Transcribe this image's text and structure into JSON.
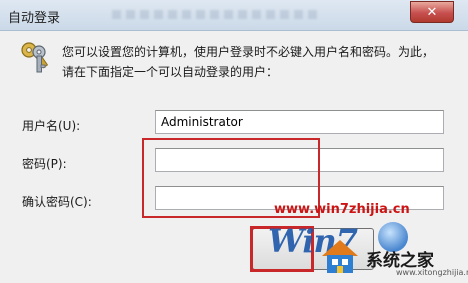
{
  "window": {
    "title": "自动登录",
    "close_glyph": "✕"
  },
  "description": {
    "line1": "您可以设置您的计算机，使用户登录时不必键入用户名和密码。为此，",
    "line2": "请在下面指定一个可以自动登录的用户："
  },
  "form": {
    "username_label": "用户名(U):",
    "username_value": "Administrator",
    "password_label": "密码(P):",
    "password_value": "",
    "confirm_label": "确认密码(C):",
    "confirm_value": ""
  },
  "watermark": {
    "url": "www.win7zhijia.cn",
    "logo_text": "Win7",
    "brand": "系统之家",
    "domain": "www.xitongzhijia.net"
  },
  "icons": {
    "key": "keys-icon",
    "close": "close-icon",
    "house": "house-icon"
  },
  "colors": {
    "highlight": "#c8282a",
    "watermark_red": "#cc1414",
    "logo_blue": "#1c56a8"
  }
}
